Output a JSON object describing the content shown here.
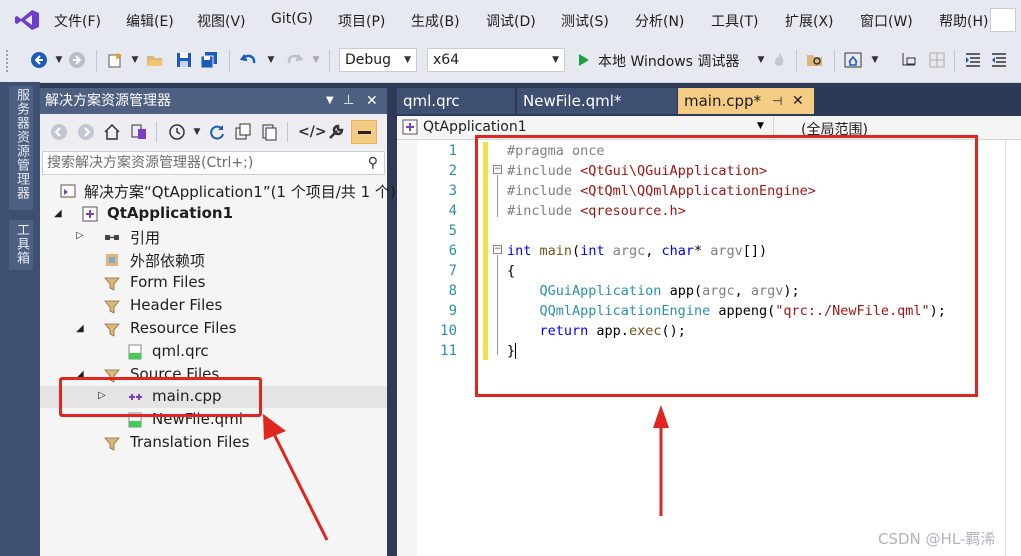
{
  "menu": [
    "文件(F)",
    "编辑(E)",
    "视图(V)",
    "Git(G)",
    "项目(P)",
    "生成(B)",
    "调试(D)",
    "测试(S)",
    "分析(N)",
    "工具(T)",
    "扩展(X)",
    "窗口(W)",
    "帮助(H)"
  ],
  "toolbar": {
    "config": "Debug",
    "platform": "x64",
    "run_label": "本地 Windows 调试器"
  },
  "left_strip": [
    "服务器资源管理器",
    "工具箱"
  ],
  "solution_explorer": {
    "title": "解决方案资源管理器",
    "search_placeholder": "搜索解决方案资源管理器(Ctrl+;)",
    "tree": [
      {
        "label": "解决方案“QtApplication1”(1 个项目/共 1 个)",
        "icon": "solution-icon"
      },
      {
        "label": "QtApplication1",
        "icon": "project-icon",
        "bold": true
      },
      {
        "label": "引用",
        "icon": "references-icon"
      },
      {
        "label": "外部依赖项",
        "icon": "external-deps-icon"
      },
      {
        "label": "Form Files",
        "icon": "filter-folder-icon"
      },
      {
        "label": "Header Files",
        "icon": "filter-folder-icon"
      },
      {
        "label": "Resource Files",
        "icon": "filter-folder-icon"
      },
      {
        "label": "qml.qrc",
        "icon": "qrc-file-icon"
      },
      {
        "label": "Source Files",
        "icon": "filter-folder-icon"
      },
      {
        "label": "main.cpp",
        "icon": "cpp-file-icon"
      },
      {
        "label": "NewFile.qml",
        "icon": "qml-file-icon"
      },
      {
        "label": "Translation Files",
        "icon": "filter-folder-icon"
      }
    ]
  },
  "editor": {
    "tabs": [
      "qml.qrc",
      "NewFile.qml*",
      "main.cpp*"
    ],
    "nav_project": "QtApplication1",
    "nav_scope": "(全局范围)",
    "line_numbers": [
      "1",
      "2",
      "3",
      "4",
      "5",
      "6",
      "7",
      "8",
      "9",
      "10",
      "11"
    ]
  },
  "watermark": "CSDN @HL-羁浠",
  "colors": {
    "accent": "#4d6082",
    "active_tab": "#f5cc84",
    "highlight": "#e0261f"
  }
}
